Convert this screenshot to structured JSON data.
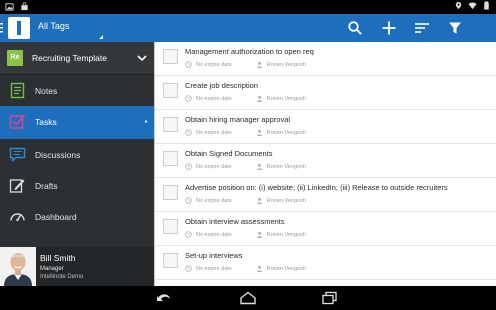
{
  "status_bar": {
    "left_icons": [
      "photo-notification-icon",
      "store-notification-icon"
    ],
    "right_icons": [
      "location-icon",
      "wifi-icon",
      "battery-icon"
    ]
  },
  "app_bar": {
    "logo_icon": "app-logo-icon",
    "tag_filter": "All Tags",
    "actions": [
      "search-icon",
      "plus-icon",
      "sort-icon",
      "filter-icon"
    ],
    "color": "#1d6fbd"
  },
  "sidebar": {
    "template": {
      "badge": "Re",
      "name": "Recruiting Template"
    },
    "items": [
      {
        "label": "Notes",
        "icon": "notes-icon"
      },
      {
        "label": "Tasks",
        "icon": "tasks-icon",
        "active": true
      },
      {
        "label": "Discussions",
        "icon": "discussions-icon"
      },
      {
        "label": "Drafts",
        "icon": "drafts-icon"
      },
      {
        "label": "Dashboard",
        "icon": "dashboard-icon"
      }
    ],
    "profile": {
      "name": "Bill Smith",
      "role": "Manager",
      "company": "Intellinote Demo"
    }
  },
  "tasks": [
    {
      "title": "Management authorization to open req",
      "due": "No expire date",
      "assignee": "Ronen Vengosh"
    },
    {
      "title": "Create job description",
      "due": "No expire date",
      "assignee": "Ronen Vengosh"
    },
    {
      "title": "Obtain hiring manager approval",
      "due": "No expire date",
      "assignee": "Ronen Vengosh"
    },
    {
      "title": "Obtain Signed Documents",
      "due": "No expire date",
      "assignee": "Ronen Vengosh"
    },
    {
      "title": "Advertise position on: (i) website; (ii) LinkedIn; (iii) Release to outside recruiters",
      "due": "No expire date",
      "assignee": "Ronen Vengosh"
    },
    {
      "title": "Obtain interview assessments",
      "due": "No expire date",
      "assignee": "Ronen Vengosh"
    },
    {
      "title": "Set-up interviews",
      "due": "No expire date",
      "assignee": "Ronen Vengosh"
    }
  ],
  "nav_bar": {
    "buttons": [
      "back-icon",
      "home-icon",
      "recents-icon"
    ]
  }
}
